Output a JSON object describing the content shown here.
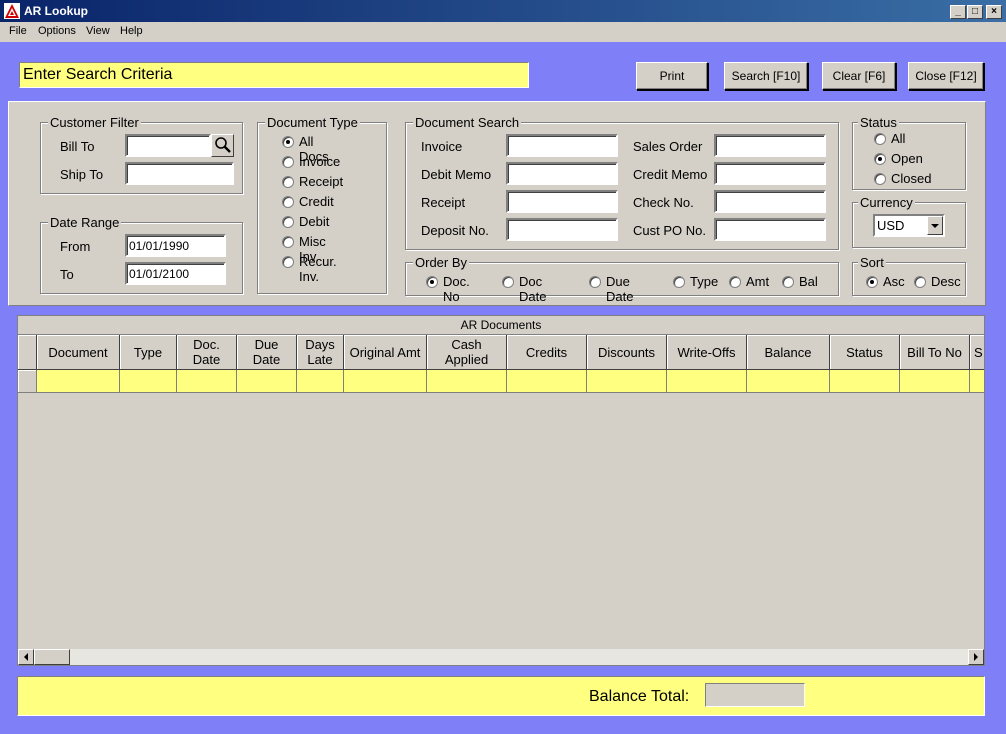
{
  "window": {
    "title": "AR Lookup",
    "controls": {
      "minimize": "_",
      "maximize": "□",
      "close": "×"
    }
  },
  "menu": [
    "File",
    "Options",
    "View",
    "Help"
  ],
  "banner": "Enter Search Criteria",
  "buttons": {
    "print": "Print",
    "search": "Search [F10]",
    "clear": "Clear [F6]",
    "close": "Close [F12]"
  },
  "customer_filter": {
    "legend": "Customer Filter",
    "bill_to_label": "Bill To",
    "bill_to_value": "",
    "ship_to_label": "Ship To",
    "ship_to_value": ""
  },
  "date_range": {
    "legend": "Date Range",
    "from_label": "From",
    "from_value": "01/01/1990",
    "to_label": "To",
    "to_value": "01/01/2100"
  },
  "document_type": {
    "legend": "Document Type",
    "options": [
      "All Docs",
      "Invoice",
      "Receipt",
      "Credit",
      "Debit",
      "Misc Inv.",
      "Recur. Inv."
    ],
    "selected": "All Docs"
  },
  "document_search": {
    "legend": "Document Search",
    "left": [
      "Invoice",
      "Debit Memo",
      "Receipt",
      "Deposit No."
    ],
    "right": [
      "Sales Order",
      "Credit Memo",
      "Check No.",
      "Cust PO No."
    ]
  },
  "order_by": {
    "legend": "Order By",
    "options": [
      "Doc. No",
      "Doc Date",
      "Due Date",
      "Type",
      "Amt",
      "Bal"
    ],
    "selected": "Doc. No"
  },
  "status": {
    "legend": "Status",
    "options": [
      "All",
      "Open",
      "Closed"
    ],
    "selected": "Open"
  },
  "currency": {
    "legend": "Currency",
    "value": "USD"
  },
  "sort": {
    "legend": "Sort",
    "options": [
      "Asc",
      "Desc"
    ],
    "selected": "Asc"
  },
  "grid": {
    "caption": "AR Documents",
    "columns": [
      "Document",
      "Type",
      "Doc.\nDate",
      "Due\nDate",
      "Days\nLate",
      "Original Amt",
      "Cash\nApplied",
      "Credits",
      "Discounts",
      "Write-Offs",
      "Balance",
      "Status",
      "Bill To No",
      "S"
    ]
  },
  "footer": {
    "balance_total_label": "Balance Total:",
    "balance_total_value": ""
  },
  "colors": {
    "background": "#7f80f8",
    "highlight_yellow": "#ffff80",
    "panel": "#d4d0c8",
    "titlebar": "#0a246a"
  }
}
